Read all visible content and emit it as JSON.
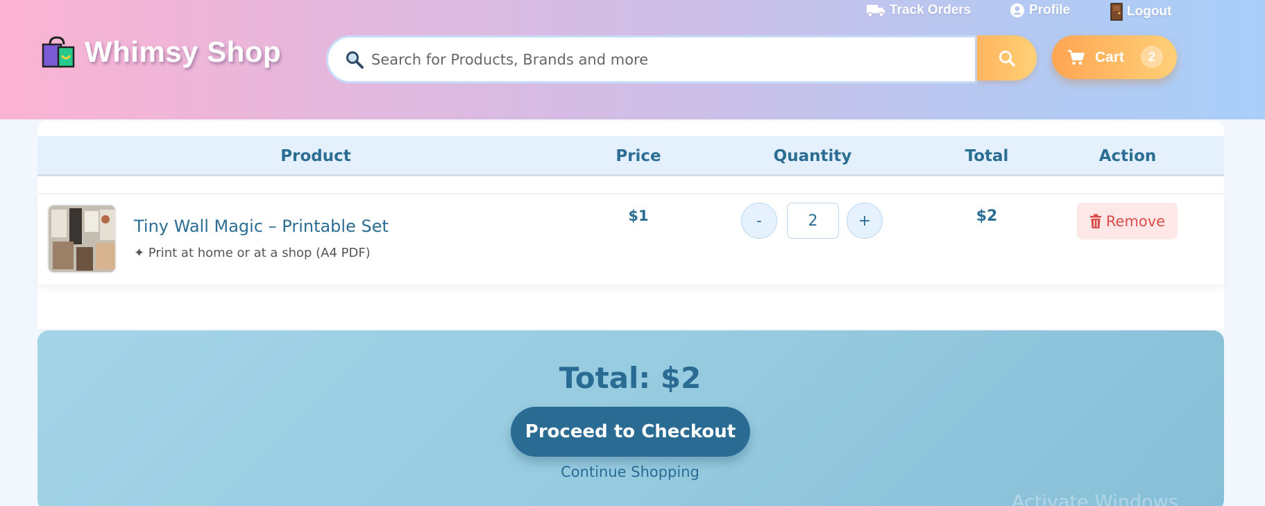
{
  "header": {
    "brand": "Whimsy Shop",
    "links": {
      "track_orders": "Track Orders",
      "profile": "Profile",
      "logout": "Logout"
    },
    "search": {
      "placeholder": "Search for Products, Brands and more",
      "value": ""
    },
    "cart": {
      "label": "Cart",
      "count": "2"
    }
  },
  "table": {
    "headers": [
      "Product",
      "Price",
      "Quantity",
      "Total",
      "Action"
    ],
    "rows": [
      {
        "name": "Tiny Wall Magic – Printable Set",
        "subtitle": "✦ Print at home or at a shop (A4 PDF)",
        "price": "$1",
        "quantity": "2",
        "minus": "-",
        "plus": "+",
        "total": "$2",
        "action": "Remove"
      }
    ]
  },
  "summary": {
    "total": "Total: $2",
    "checkout": "Proceed to Checkout",
    "continue": "Continue Shopping"
  },
  "overlay": {
    "watermark": "Activate Windows"
  },
  "colors": {
    "accent": "#2a6b93",
    "cart_orange": "#ffa552",
    "remove_red": "#dc4b4b"
  }
}
